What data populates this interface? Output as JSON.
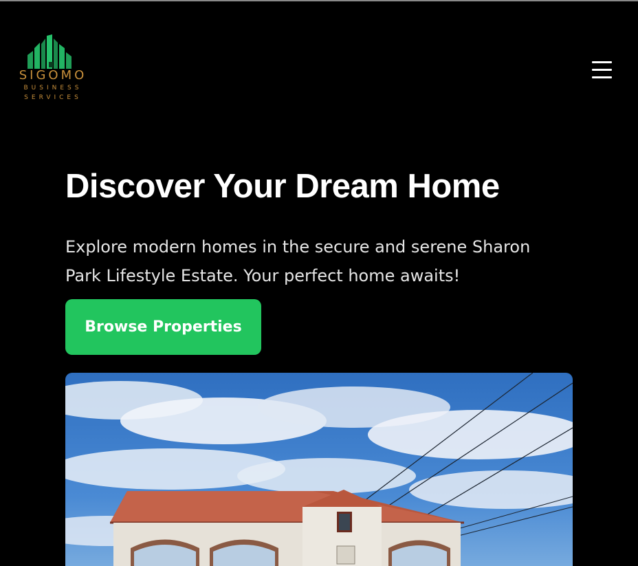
{
  "header": {
    "logo": {
      "name": "SIGOMO",
      "sub_line1": "BUSINESS",
      "sub_line2": "SERVICES",
      "icon": "buildings-icon"
    },
    "menu_icon": "hamburger-menu-icon"
  },
  "hero": {
    "title": "Discover Your Dream Home",
    "description": "Explore modern homes in the secure and serene Sharon Park Lifestyle Estate. Your perfect home awaits!",
    "cta_label": "Browse Properties",
    "image_icon": "estate-gatehouse-photo"
  },
  "colors": {
    "background": "#000000",
    "accent": "#22c55e",
    "logo_green": "#1f9e57",
    "logo_gold": "#c9903b",
    "text": "#ffffff"
  }
}
